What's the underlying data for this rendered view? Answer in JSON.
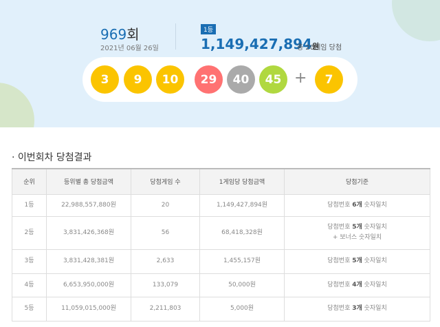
{
  "draw": {
    "round": "969",
    "round_suffix": "회",
    "date": "2021년 06월 26일",
    "rank_badge": "1등",
    "prize": "1,149,427,894",
    "won": "원",
    "games": "총 20게임 당첨",
    "numbers": [
      {
        "n": "3",
        "color": "#fbc400"
      },
      {
        "n": "9",
        "color": "#fbc400"
      },
      {
        "n": "10",
        "color": "#fbc400"
      },
      {
        "n": "29",
        "color": "#ff7272"
      },
      {
        "n": "40",
        "color": "#aaaaaa"
      },
      {
        "n": "45",
        "color": "#b0d840"
      }
    ],
    "plus": "+",
    "bonus": {
      "n": "7",
      "color": "#fbc400"
    }
  },
  "section_title": "· 이번회차 당첨결과",
  "table": {
    "headers": [
      "순위",
      "등위별 총 당첨금액",
      "당첨게임 수",
      "1게임당 당첨금액",
      "당첨기준"
    ],
    "rows": [
      {
        "rank": "1등",
        "total": "22,988,557,880원",
        "count": "20",
        "each": "1,149,427,894원",
        "c1": "당첨번호 ",
        "c2": "6개",
        "c3": " 숫자일치",
        "c4": ""
      },
      {
        "rank": "2등",
        "total": "3,831,426,368원",
        "count": "56",
        "each": "68,418,328원",
        "c1": "당첨번호 ",
        "c2": "5개",
        "c3": " 숫자일치",
        "c4": "+ 보너스 숫자일치"
      },
      {
        "rank": "3등",
        "total": "3,831,428,381원",
        "count": "2,633",
        "each": "1,455,157원",
        "c1": "당첨번호 ",
        "c2": "5개",
        "c3": " 숫자일치",
        "c4": ""
      },
      {
        "rank": "4등",
        "total": "6,653,950,000원",
        "count": "133,079",
        "each": "50,000원",
        "c1": "당첨번호 ",
        "c2": "4개",
        "c3": " 숫자일치",
        "c4": ""
      },
      {
        "rank": "5등",
        "total": "11,059,015,000원",
        "count": "2,211,803",
        "each": "5,000원",
        "c1": "당첨번호 ",
        "c2": "3개",
        "c3": " 숫자일치",
        "c4": ""
      }
    ]
  }
}
